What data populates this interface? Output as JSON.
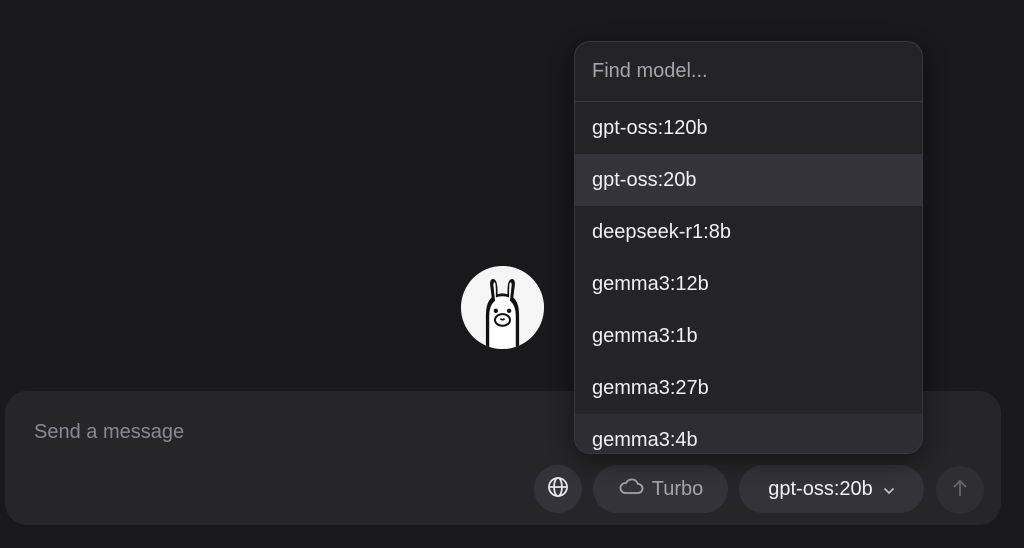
{
  "composer": {
    "placeholder": "Send a message",
    "turbo_label": "Turbo",
    "selected_model": "gpt-oss:20b"
  },
  "model_picker": {
    "search_placeholder": "Find model...",
    "models": [
      {
        "label": "gpt-oss:120b"
      },
      {
        "label": "gpt-oss:20b"
      },
      {
        "label": "deepseek-r1:8b"
      },
      {
        "label": "gemma3:12b"
      },
      {
        "label": "gemma3:1b"
      },
      {
        "label": "gemma3:27b"
      },
      {
        "label": "gemma3:4b"
      }
    ],
    "selected_index": 1
  },
  "icons": {
    "logo": "llama-logo-icon",
    "web": "globe-icon",
    "turbo": "cloud-icon",
    "model_chevron": "chevron-down-icon",
    "send": "arrow-up-icon"
  },
  "colors": {
    "background": "#19181a",
    "composer": "#262528",
    "button": "#343337",
    "dropdown": "#242326"
  }
}
